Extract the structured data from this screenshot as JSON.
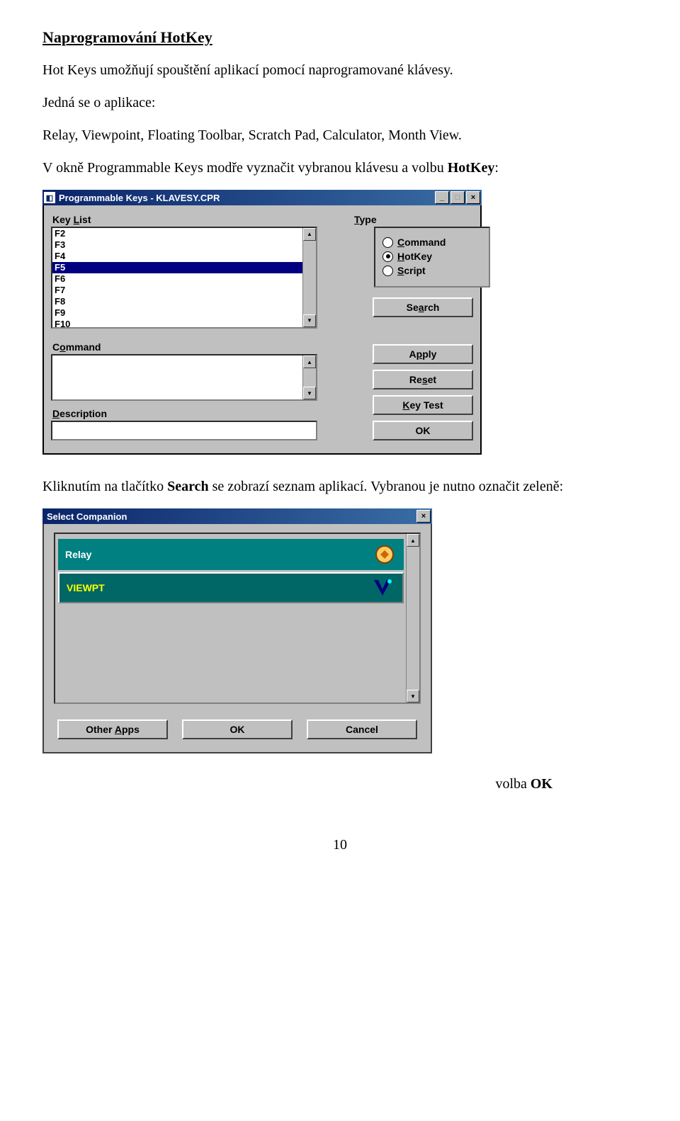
{
  "heading": "Naprogramování HotKey",
  "intro1": "Hot Keys umožňují spouštění aplikací pomocí naprogramované klávesy.",
  "intro2": "Jedná se o aplikace:",
  "intro3": "Relay, Viewpoint, Floating Toolbar, Scratch Pad, Calculator, Month View.",
  "intro4_a": "V okně Programmable Keys modře vyznačit vybranou klávesu a volbu ",
  "intro4_b": "HotKey",
  "intro4_c": ":",
  "progkeys": {
    "title": "Programmable Keys - KLAVESY.CPR",
    "keylist_label_pre": "Key ",
    "keylist_label_u": "L",
    "keylist_label_post": "ist",
    "items": [
      "F2",
      "F3",
      "F4",
      "F5",
      "F6",
      "F7",
      "F8",
      "F9",
      "F10"
    ],
    "selected": "F5",
    "type_label_u": "T",
    "type_label_post": "ype",
    "radios": {
      "command_u": "C",
      "command_post": "ommand",
      "hotkey_u": "H",
      "hotkey_post": "otKey",
      "script_u": "S",
      "script_post": "cript",
      "selected": "HotKey"
    },
    "buttons": {
      "search_pre": "Se",
      "search_u": "a",
      "search_post": "rch",
      "apply_pre": "A",
      "apply_u": "p",
      "apply_post": "ply",
      "reset_pre": "Re",
      "reset_u": "s",
      "reset_post": "et",
      "keytest_u": "K",
      "keytest_post": "ey Test",
      "ok": "OK"
    },
    "command_label_pre": "C",
    "command_label_u": "o",
    "command_label_post": "mmand",
    "desc_label_u": "D",
    "desc_label_post": "escription"
  },
  "mid_a": "Kliknutím na tlačítko ",
  "mid_b": "Search",
  "mid_c": " se zobrazí seznam aplikací. Vybranou je nutno označit zeleně:",
  "companion": {
    "title": "Select Companion",
    "items": {
      "relay": "Relay",
      "viewpt": "VIEWPT"
    },
    "buttons": {
      "other_pre": "Other ",
      "other_u": "A",
      "other_post": "pps",
      "ok": "OK",
      "cancel": "Cancel"
    }
  },
  "volba_ok_a": "volba ",
  "volba_ok_b": "OK",
  "page_number": "10"
}
